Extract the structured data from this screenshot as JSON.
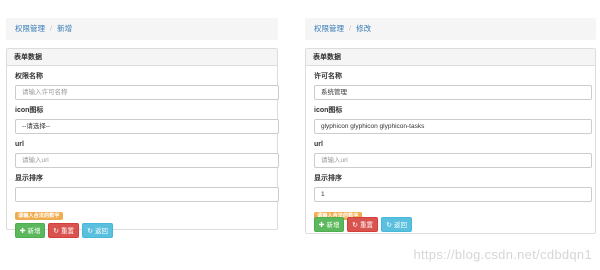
{
  "left": {
    "breadcrumb": {
      "parent": "权限管理",
      "separator": "/",
      "current": "新增"
    },
    "card_title": "表单数据",
    "fields": [
      {
        "label": "权限名称",
        "value": "请输入许可名称",
        "is_placeholder": true
      },
      {
        "label": "icon图标",
        "value": "--请选择--",
        "is_placeholder": false
      },
      {
        "label": "url",
        "value": "请输入url",
        "is_placeholder": true
      },
      {
        "label": "显示排序",
        "value": "",
        "is_placeholder": true
      }
    ],
    "validation_badge": "请输入合法的数字",
    "buttons": {
      "add": "新增",
      "reset": "重置",
      "back": "返回"
    }
  },
  "right": {
    "breadcrumb": {
      "parent": "权限管理",
      "separator": "/",
      "current": "修改"
    },
    "card_title": "表单数据",
    "fields": [
      {
        "label": "许可名称",
        "value": "系统管理",
        "is_placeholder": false
      },
      {
        "label": "icon图标",
        "value": "glyphicon glyphicon glyphicon-tasks",
        "is_placeholder": false
      },
      {
        "label": "url",
        "value": "请输入url",
        "is_placeholder": true
      },
      {
        "label": "显示排序",
        "value": "1",
        "is_placeholder": false
      }
    ],
    "validation_badge": "请输入合法的数字",
    "buttons": {
      "add": "新增",
      "reset": "重置",
      "back": "返回"
    }
  },
  "icons": {
    "add": "plus-icon",
    "reset": "refresh-icon",
    "back": "refresh-icon"
  },
  "colors": {
    "link": "#337ab7",
    "success": "#5cb85c",
    "danger": "#d9534f",
    "info": "#5bc0de",
    "warning": "#f0ad4e"
  },
  "watermark": "https://blog.csdn.net/cdbdqn1"
}
